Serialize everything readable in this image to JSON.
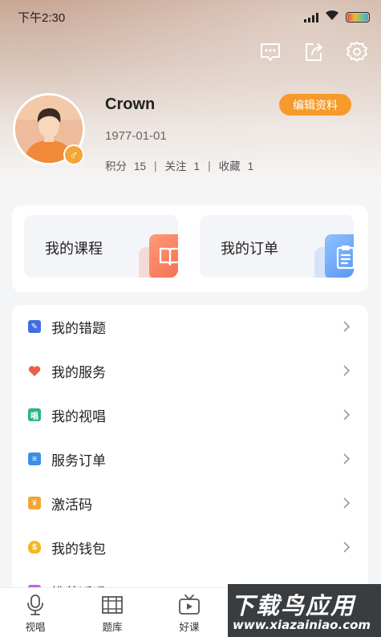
{
  "status_bar": {
    "time": "下午2:30"
  },
  "profile": {
    "name": "Crown",
    "birthday": "1977-01-01",
    "edit_label": "编辑资料",
    "gender_symbol": "♂",
    "stats": [
      {
        "label": "积分",
        "value": "15"
      },
      {
        "label": "关注",
        "value": "1"
      },
      {
        "label": "收藏",
        "value": "1"
      }
    ]
  },
  "shortcuts": {
    "course_label": "我的课程",
    "order_label": "我的订单"
  },
  "menu": {
    "items": [
      {
        "label": "我的错题",
        "icon": "wrong-questions-icon",
        "color": "#3f6fe0"
      },
      {
        "label": "我的服务",
        "icon": "heart-service-icon",
        "color": "#ee5d4c"
      },
      {
        "label": "我的视唱",
        "icon": "sight-singing-icon",
        "color": "#2bb38a"
      },
      {
        "label": "服务订单",
        "icon": "document-icon",
        "color": "#3e8ee8"
      },
      {
        "label": "激活码",
        "icon": "activation-code-icon",
        "color": "#f3a536"
      },
      {
        "label": "我的钱包",
        "icon": "wallet-icon",
        "color": "#f5b822"
      },
      {
        "label": "推荐返现",
        "icon": "recommend-icon",
        "color": "#b46be0"
      }
    ]
  },
  "tabbar": {
    "tabs": [
      {
        "label": "视唱",
        "icon": "microphone-icon"
      },
      {
        "label": "题库",
        "icon": "question-bank-icon"
      },
      {
        "label": "好课",
        "icon": "video-course-icon"
      }
    ]
  },
  "watermark": {
    "title": "下载鸟应用",
    "url": "www.xiazainiao.com"
  },
  "colors": {
    "accent": "#f59a2b",
    "background": "#f4f5f7"
  }
}
